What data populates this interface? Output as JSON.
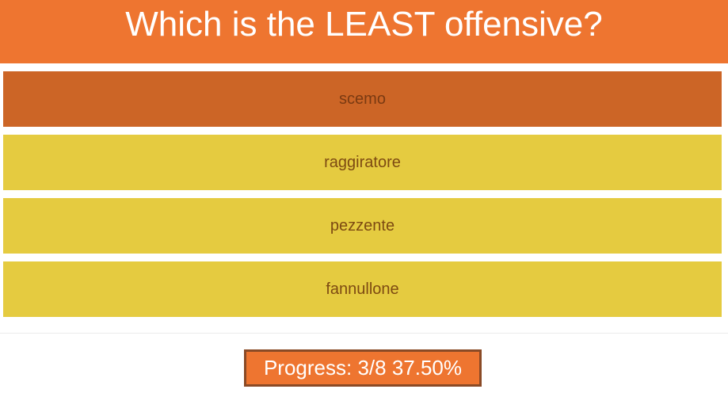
{
  "header": {
    "question": "Which is the LEAST offensive?"
  },
  "options": [
    {
      "label": "scemo",
      "state": "selected"
    },
    {
      "label": "raggiratore",
      "state": "normal"
    },
    {
      "label": "pezzente",
      "state": "normal"
    },
    {
      "label": "fannullone",
      "state": "normal"
    }
  ],
  "progress": {
    "text": "Progress: 3/8 37.50%",
    "current": 3,
    "total": 8,
    "percent": 37.5
  },
  "colors": {
    "header_bg": "#ee7530",
    "option_selected_bg": "#cc6526",
    "option_bg": "#e5cb40",
    "progress_border": "#8a4a26"
  }
}
